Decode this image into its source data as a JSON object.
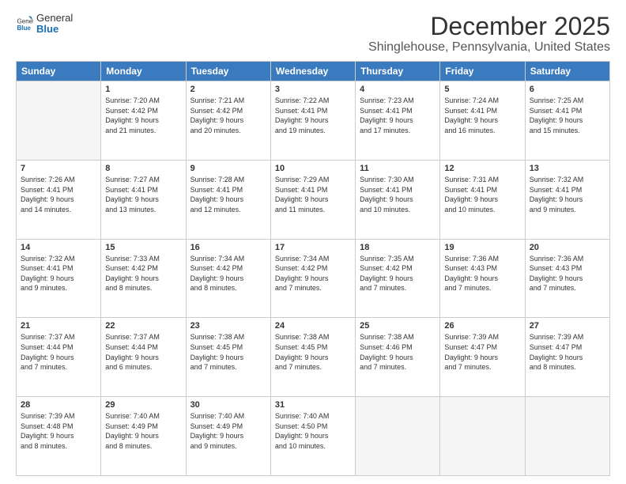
{
  "header": {
    "logo": {
      "general": "General",
      "blue": "Blue"
    },
    "title": "December 2025",
    "subtitle": "Shinglehouse, Pennsylvania, United States"
  },
  "calendar": {
    "days_of_week": [
      "Sunday",
      "Monday",
      "Tuesday",
      "Wednesday",
      "Thursday",
      "Friday",
      "Saturday"
    ],
    "weeks": [
      [
        {
          "day": "",
          "info": ""
        },
        {
          "day": "1",
          "info": "Sunrise: 7:20 AM\nSunset: 4:42 PM\nDaylight: 9 hours\nand 21 minutes."
        },
        {
          "day": "2",
          "info": "Sunrise: 7:21 AM\nSunset: 4:42 PM\nDaylight: 9 hours\nand 20 minutes."
        },
        {
          "day": "3",
          "info": "Sunrise: 7:22 AM\nSunset: 4:41 PM\nDaylight: 9 hours\nand 19 minutes."
        },
        {
          "day": "4",
          "info": "Sunrise: 7:23 AM\nSunset: 4:41 PM\nDaylight: 9 hours\nand 17 minutes."
        },
        {
          "day": "5",
          "info": "Sunrise: 7:24 AM\nSunset: 4:41 PM\nDaylight: 9 hours\nand 16 minutes."
        },
        {
          "day": "6",
          "info": "Sunrise: 7:25 AM\nSunset: 4:41 PM\nDaylight: 9 hours\nand 15 minutes."
        }
      ],
      [
        {
          "day": "7",
          "info": "Sunrise: 7:26 AM\nSunset: 4:41 PM\nDaylight: 9 hours\nand 14 minutes."
        },
        {
          "day": "8",
          "info": "Sunrise: 7:27 AM\nSunset: 4:41 PM\nDaylight: 9 hours\nand 13 minutes."
        },
        {
          "day": "9",
          "info": "Sunrise: 7:28 AM\nSunset: 4:41 PM\nDaylight: 9 hours\nand 12 minutes."
        },
        {
          "day": "10",
          "info": "Sunrise: 7:29 AM\nSunset: 4:41 PM\nDaylight: 9 hours\nand 11 minutes."
        },
        {
          "day": "11",
          "info": "Sunrise: 7:30 AM\nSunset: 4:41 PM\nDaylight: 9 hours\nand 10 minutes."
        },
        {
          "day": "12",
          "info": "Sunrise: 7:31 AM\nSunset: 4:41 PM\nDaylight: 9 hours\nand 10 minutes."
        },
        {
          "day": "13",
          "info": "Sunrise: 7:32 AM\nSunset: 4:41 PM\nDaylight: 9 hours\nand 9 minutes."
        }
      ],
      [
        {
          "day": "14",
          "info": "Sunrise: 7:32 AM\nSunset: 4:41 PM\nDaylight: 9 hours\nand 9 minutes."
        },
        {
          "day": "15",
          "info": "Sunrise: 7:33 AM\nSunset: 4:42 PM\nDaylight: 9 hours\nand 8 minutes."
        },
        {
          "day": "16",
          "info": "Sunrise: 7:34 AM\nSunset: 4:42 PM\nDaylight: 9 hours\nand 8 minutes."
        },
        {
          "day": "17",
          "info": "Sunrise: 7:34 AM\nSunset: 4:42 PM\nDaylight: 9 hours\nand 7 minutes."
        },
        {
          "day": "18",
          "info": "Sunrise: 7:35 AM\nSunset: 4:42 PM\nDaylight: 9 hours\nand 7 minutes."
        },
        {
          "day": "19",
          "info": "Sunrise: 7:36 AM\nSunset: 4:43 PM\nDaylight: 9 hours\nand 7 minutes."
        },
        {
          "day": "20",
          "info": "Sunrise: 7:36 AM\nSunset: 4:43 PM\nDaylight: 9 hours\nand 7 minutes."
        }
      ],
      [
        {
          "day": "21",
          "info": "Sunrise: 7:37 AM\nSunset: 4:44 PM\nDaylight: 9 hours\nand 7 minutes."
        },
        {
          "day": "22",
          "info": "Sunrise: 7:37 AM\nSunset: 4:44 PM\nDaylight: 9 hours\nand 6 minutes."
        },
        {
          "day": "23",
          "info": "Sunrise: 7:38 AM\nSunset: 4:45 PM\nDaylight: 9 hours\nand 7 minutes."
        },
        {
          "day": "24",
          "info": "Sunrise: 7:38 AM\nSunset: 4:45 PM\nDaylight: 9 hours\nand 7 minutes."
        },
        {
          "day": "25",
          "info": "Sunrise: 7:38 AM\nSunset: 4:46 PM\nDaylight: 9 hours\nand 7 minutes."
        },
        {
          "day": "26",
          "info": "Sunrise: 7:39 AM\nSunset: 4:47 PM\nDaylight: 9 hours\nand 7 minutes."
        },
        {
          "day": "27",
          "info": "Sunrise: 7:39 AM\nSunset: 4:47 PM\nDaylight: 9 hours\nand 8 minutes."
        }
      ],
      [
        {
          "day": "28",
          "info": "Sunrise: 7:39 AM\nSunset: 4:48 PM\nDaylight: 9 hours\nand 8 minutes."
        },
        {
          "day": "29",
          "info": "Sunrise: 7:40 AM\nSunset: 4:49 PM\nDaylight: 9 hours\nand 8 minutes."
        },
        {
          "day": "30",
          "info": "Sunrise: 7:40 AM\nSunset: 4:49 PM\nDaylight: 9 hours\nand 9 minutes."
        },
        {
          "day": "31",
          "info": "Sunrise: 7:40 AM\nSunset: 4:50 PM\nDaylight: 9 hours\nand 10 minutes."
        },
        {
          "day": "",
          "info": ""
        },
        {
          "day": "",
          "info": ""
        },
        {
          "day": "",
          "info": ""
        }
      ]
    ]
  }
}
